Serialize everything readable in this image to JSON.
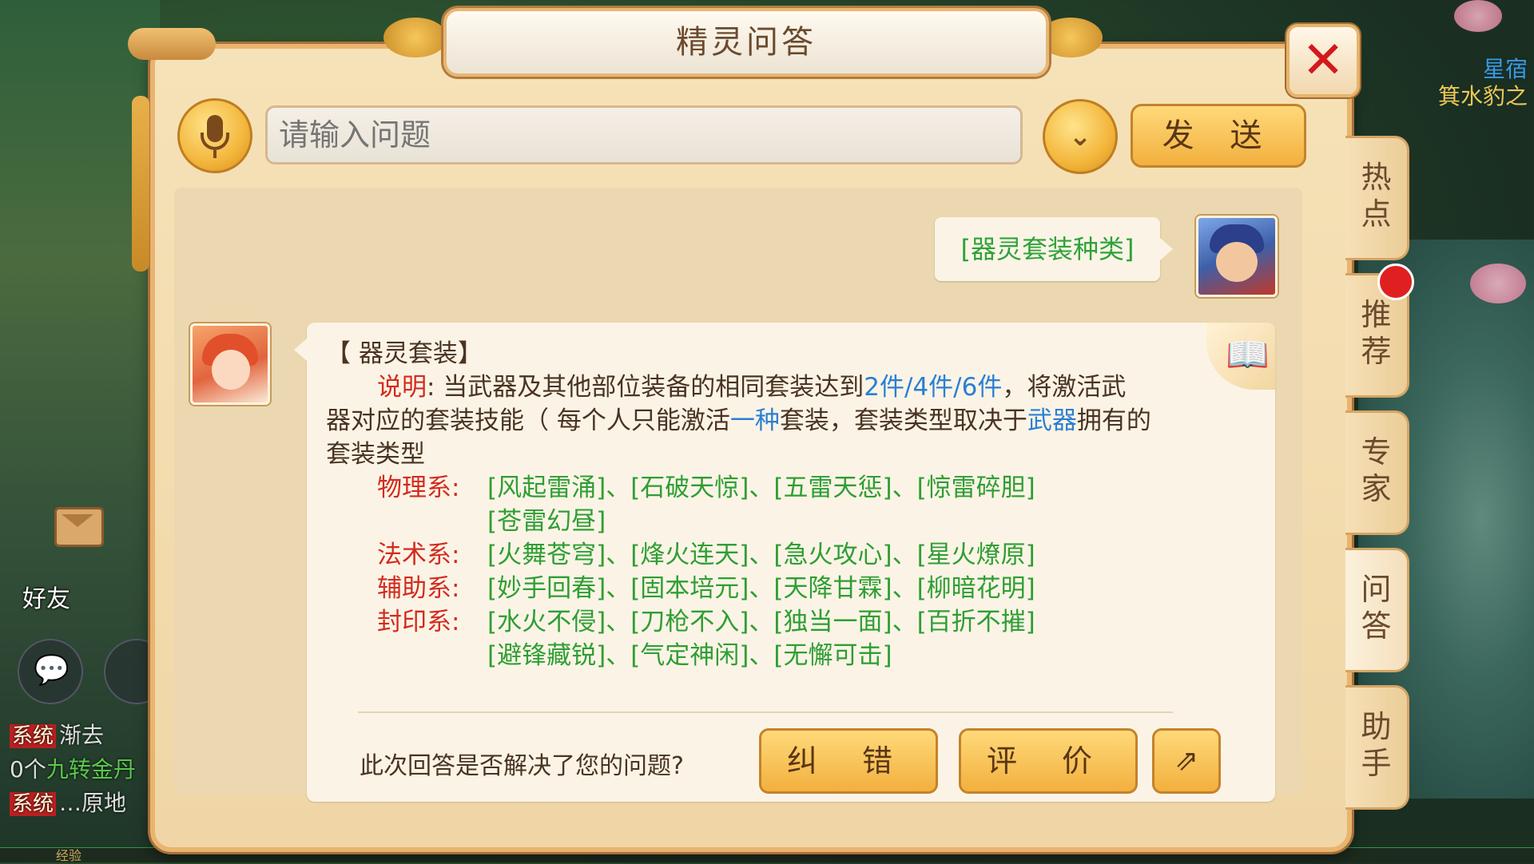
{
  "dialog": {
    "title": "精灵问答",
    "close_label": "✕"
  },
  "input": {
    "placeholder": "请输入问题",
    "dropdown_icon": "chevron-down-icon",
    "send_label": "发 送"
  },
  "conversation": {
    "user_message": "[器灵套装种类]",
    "answer": {
      "heading": "【 器灵套装】",
      "desc_label": "说明",
      "desc_part1": ": 当武器及其他部位装备的相同套装达到",
      "desc_highlight1": "2件/4件/6件",
      "desc_part2": "，将激活武",
      "desc_part3": "器对应的套装技能（ 每个人只能激活",
      "desc_highlight2": "一种",
      "desc_part4": "套装，套装类型取决于",
      "desc_highlight3": "武器",
      "desc_part5": "拥有的",
      "desc_part6": "套装类型",
      "categories": [
        {
          "label": "物理系:",
          "line1": "[风起雷涌]、[石破天惊]、[五雷天惩]、[惊雷碎胆]",
          "line2": "[苍雷幻昼]"
        },
        {
          "label": "法术系:",
          "line1": "[火舞苍穹]、[烽火连天]、[急火攻心]、[星火燎原]",
          "line2": ""
        },
        {
          "label": "辅助系:",
          "line1": "[妙手回春]、[固本培元]、[天降甘霖]、[柳暗花明]",
          "line2": ""
        },
        {
          "label": "封印系:",
          "line1": "[水火不侵]、[刀枪不入]、[独当一面]、[百折不摧]",
          "line2": "[避锋藏锐]、[气定神闲]、[无懈可击]"
        }
      ]
    },
    "feedback": {
      "question": "此次回答是否解决了您的问题?",
      "correct_label": "纠 错",
      "rate_label": "评 价",
      "share_icon": "share-icon"
    }
  },
  "tabs": [
    {
      "label": "热\n点"
    },
    {
      "label": "推\n荐"
    },
    {
      "label": "专\n家"
    },
    {
      "label": "问\n答"
    },
    {
      "label": "助\n手"
    }
  ],
  "background": {
    "star_line1": "星宿",
    "star_line2": "箕水豹之",
    "friend_label": "好友",
    "chat": [
      {
        "tag": "系统",
        "text": "渐去"
      },
      {
        "tag": "",
        "text": "0个",
        "highlight": "九转金丹"
      },
      {
        "tag": "系统",
        "text": "…原地"
      }
    ],
    "exp_label": "经验"
  }
}
